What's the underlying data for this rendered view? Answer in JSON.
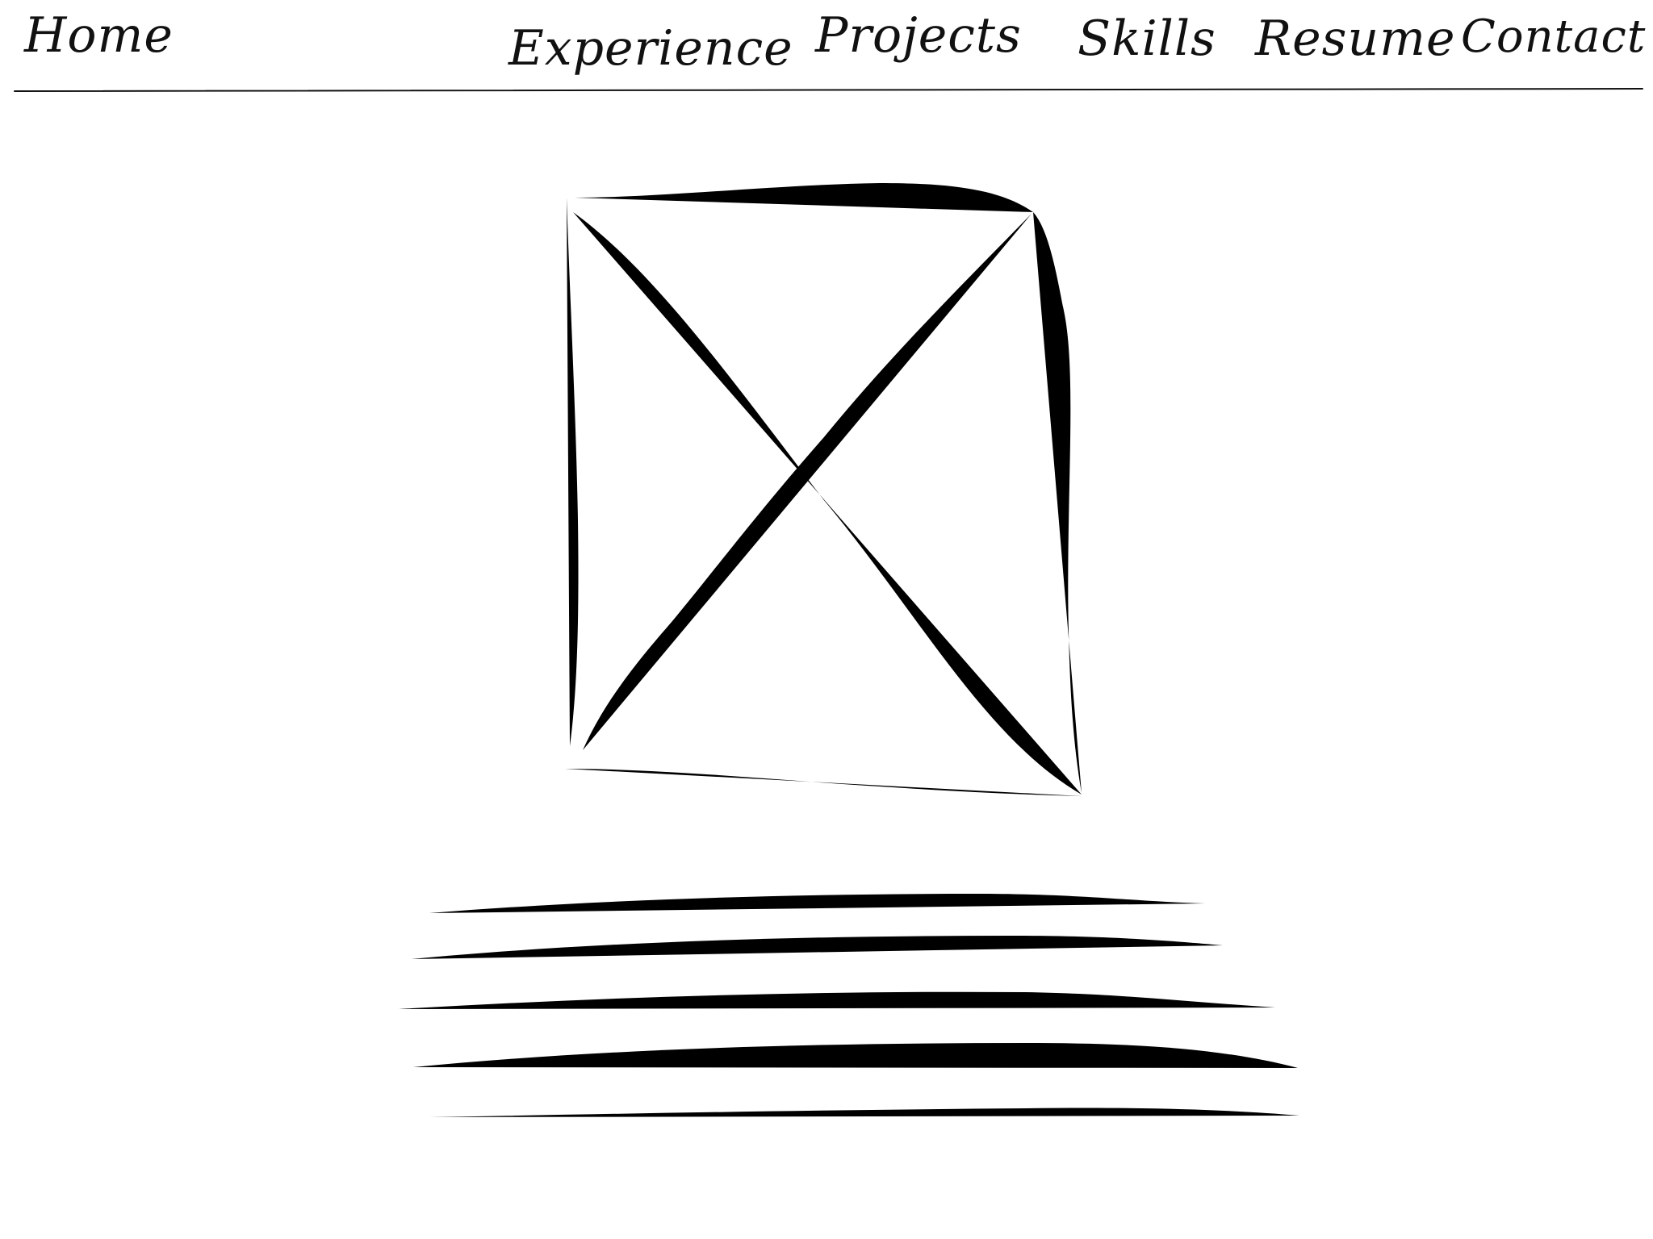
{
  "nav": {
    "home": "Home",
    "experience": "Experience",
    "projects": "Projects",
    "skills": "Skills",
    "resume": "Resume",
    "contact": "Contact"
  },
  "main": {
    "image_icon": "image-placeholder-icon",
    "paragraph_line_count": 5
  },
  "colors": {
    "ink": "#111111",
    "paper": "#ffffff"
  }
}
